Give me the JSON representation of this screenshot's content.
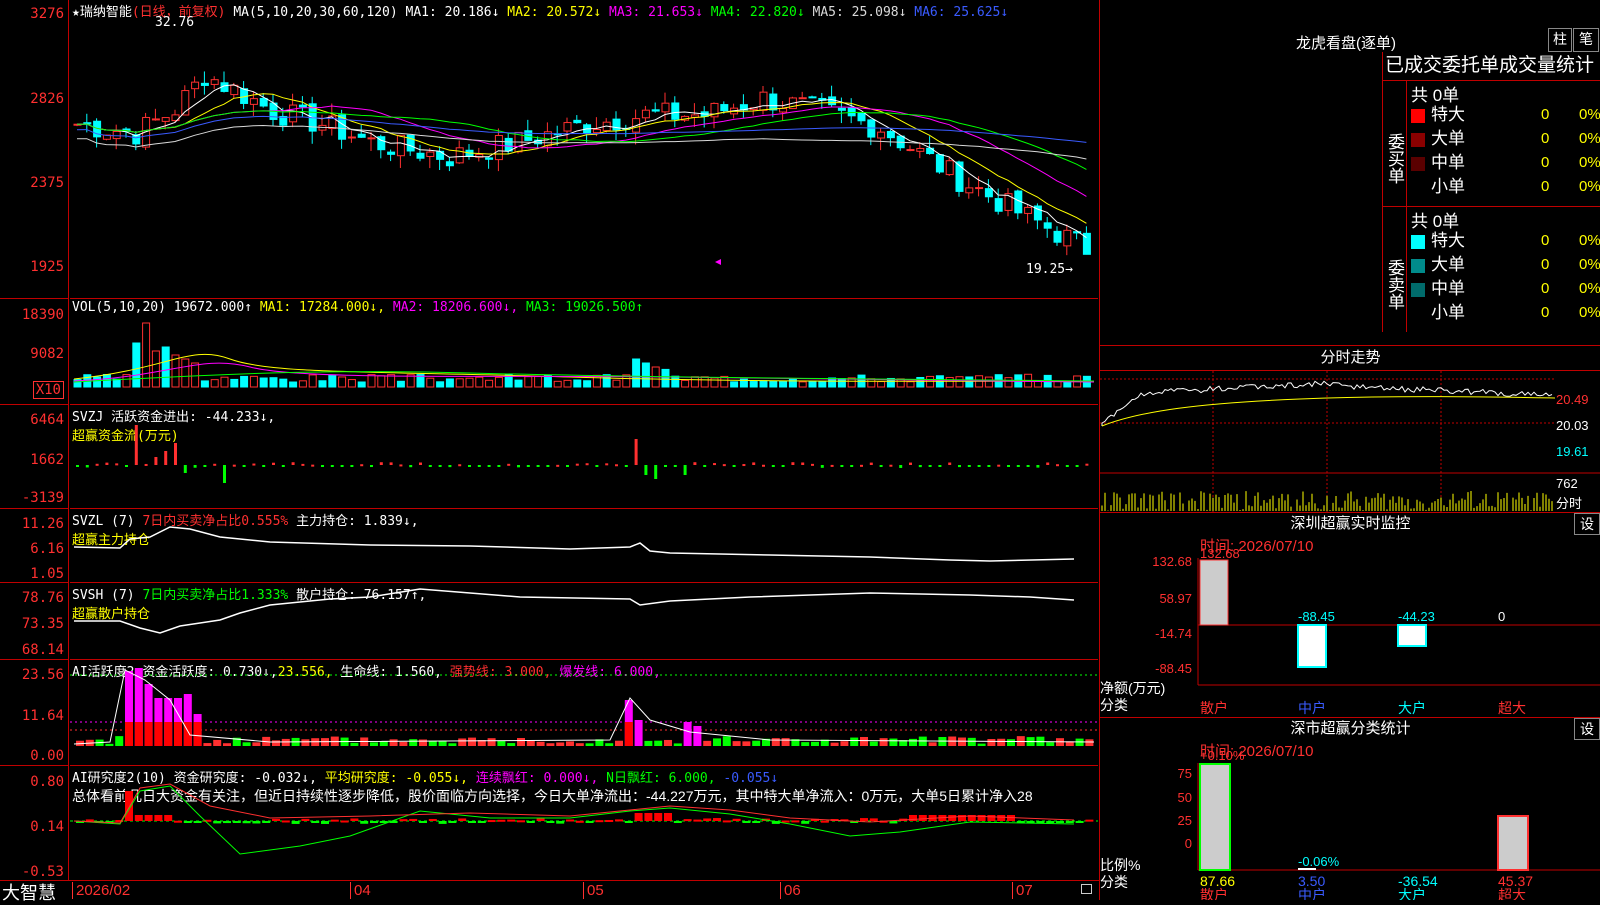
{
  "stock": {
    "name": "★瑞纳智能",
    "period": "(日线，前复权)"
  },
  "kline": {
    "ma_label": "MA(5,10,20,30,60,120)",
    "ma_values": [
      {
        "label": "MA1: 20.186↓",
        "color": "#ffffff"
      },
      {
        "label": "MA2: 20.572↓",
        "color": "#ffff00"
      },
      {
        "label": "MA3: 21.653↓",
        "color": "#ff00ff"
      },
      {
        "label": "MA4: 22.820↓",
        "color": "#00ff00"
      },
      {
        "label": "MA5: 25.098↓",
        "color": "#d9d9d9"
      },
      {
        "label": "MA6: 25.625↓",
        "color": "#3a5bff"
      }
    ],
    "high_label": "32.76",
    "low_label": "19.25→",
    "axis": [
      "3276",
      "2826",
      "2375",
      "1925"
    ]
  },
  "vol": {
    "label": "VOL(5,10,20)",
    "value": "19672.000↑",
    "ma1": "MA1: 17284.000↓,",
    "ma2": "MA2: 18206.600↓,",
    "ma3": "MA3: 19026.500↑",
    "axis": [
      "18390",
      "9082"
    ],
    "unit": "X10"
  },
  "svzj": {
    "line1": "SVZJ  活跃资金进出: -44.233↓,",
    "line2": "超赢资金流(万元)",
    "axis": [
      "6464",
      "1662",
      "-3139"
    ]
  },
  "svzl": {
    "prefix": "SVZL (7)",
    "pct": "7日内买卖净占比0.555%",
    "hold": "主力持仓: 1.839↓,",
    "line2": "超赢主力持仓",
    "axis": [
      "11.26",
      "6.16",
      "1.05"
    ]
  },
  "svsh": {
    "prefix": "SVSH (7)",
    "pct": "7日内买卖净占比1.333%",
    "hold": "散户持仓: 76.157↑,",
    "line2": "超赢散户持仓",
    "axis": [
      "78.76",
      "73.35",
      "68.14"
    ]
  },
  "ai1": {
    "prefix": "AI活跃度2",
    "act": "资金活跃度: 0.730↓,",
    "v2": "23.556,",
    "life": "生命线: 1.560,",
    "strong": "强势线: 3.000,",
    "burst": "爆发线: 6.000,",
    "axis": [
      "23.56",
      "11.64",
      "0.00"
    ]
  },
  "ai2": {
    "prefix": "AI研究度2(10)",
    "res": "资金研究度: -0.032↓,",
    "avg": "平均研究度: -0.055↓,",
    "red": "连续飘红: 0.000↓,",
    "n": "N日飘红: 6.000,",
    "neg": "-0.055↓",
    "summary": "总体看前几日大资金有关注，但近日持续性逐步降低，股价面临方向选择，今日大单净流出：-44.227万元，其中特大单净流入：0万元，大单5日累计净入28",
    "axis": [
      "0.80",
      "0.14",
      "-0.53"
    ]
  },
  "bottom": {
    "brand": "大智慧",
    "dates": [
      "2026/02",
      "04",
      "05",
      "06",
      "07"
    ]
  },
  "right": {
    "title": "龙虎看盘(逐单)",
    "btn1": "柱",
    "btn2": "笔",
    "tabs": "已成交委托单成交量统计",
    "buy": {
      "side": "委买单",
      "total": "共 0单",
      "rows": [
        {
          "label": "特大",
          "color": "#ff0000",
          "n": "0",
          "p": "0%"
        },
        {
          "label": "大单",
          "color": "#8b0000",
          "n": "0",
          "p": "0%"
        },
        {
          "label": "中单",
          "color": "#5a0000",
          "n": "0",
          "p": "0%"
        },
        {
          "label": "小单",
          "color": "#000000",
          "n": "0",
          "p": "0%"
        }
      ]
    },
    "sell": {
      "side": "委卖单",
      "total": "共 0单",
      "rows": [
        {
          "label": "特大",
          "color": "#00ffff",
          "n": "0",
          "p": "0%"
        },
        {
          "label": "大单",
          "color": "#008b8b",
          "n": "0",
          "p": "0%"
        },
        {
          "label": "中单",
          "color": "#006b6b",
          "n": "0",
          "p": "0%"
        },
        {
          "label": "小单",
          "color": "#000000",
          "n": "0",
          "p": "0%"
        }
      ]
    },
    "timeshare": {
      "title": "分时走势",
      "axis": [
        "20.49",
        "20.03",
        "19.61"
      ],
      "vol_axis": [
        "762",
        "分时"
      ]
    },
    "monitor": {
      "title": "深圳超赢实时监控",
      "set": "设",
      "time": "时间: 2026/07/10",
      "axis": [
        "132.68",
        "58.97",
        "-14.74",
        "-88.45"
      ],
      "ylabel": "净额(万元)",
      "xlabel": "分类",
      "cats": [
        "散户",
        "中户",
        "大户",
        "超大"
      ],
      "values": [
        "132.68",
        "-88.45",
        "-44.23",
        "0"
      ]
    },
    "classify": {
      "title": "深市超赢分类统计",
      "set": "设",
      "time": "时间: 2026/07/10",
      "axis": [
        "75",
        "50",
        "25",
        "0"
      ],
      "ylabel": "比例%",
      "xlabel": "分类",
      "cats": [
        "散户",
        "中户",
        "大户",
        "超大"
      ],
      "top": [
        "+0.10%",
        "-0.06%",
        "",
        ""
      ],
      "values": [
        "87.66",
        "3.50",
        "-36.54",
        "45.37"
      ]
    }
  }
}
